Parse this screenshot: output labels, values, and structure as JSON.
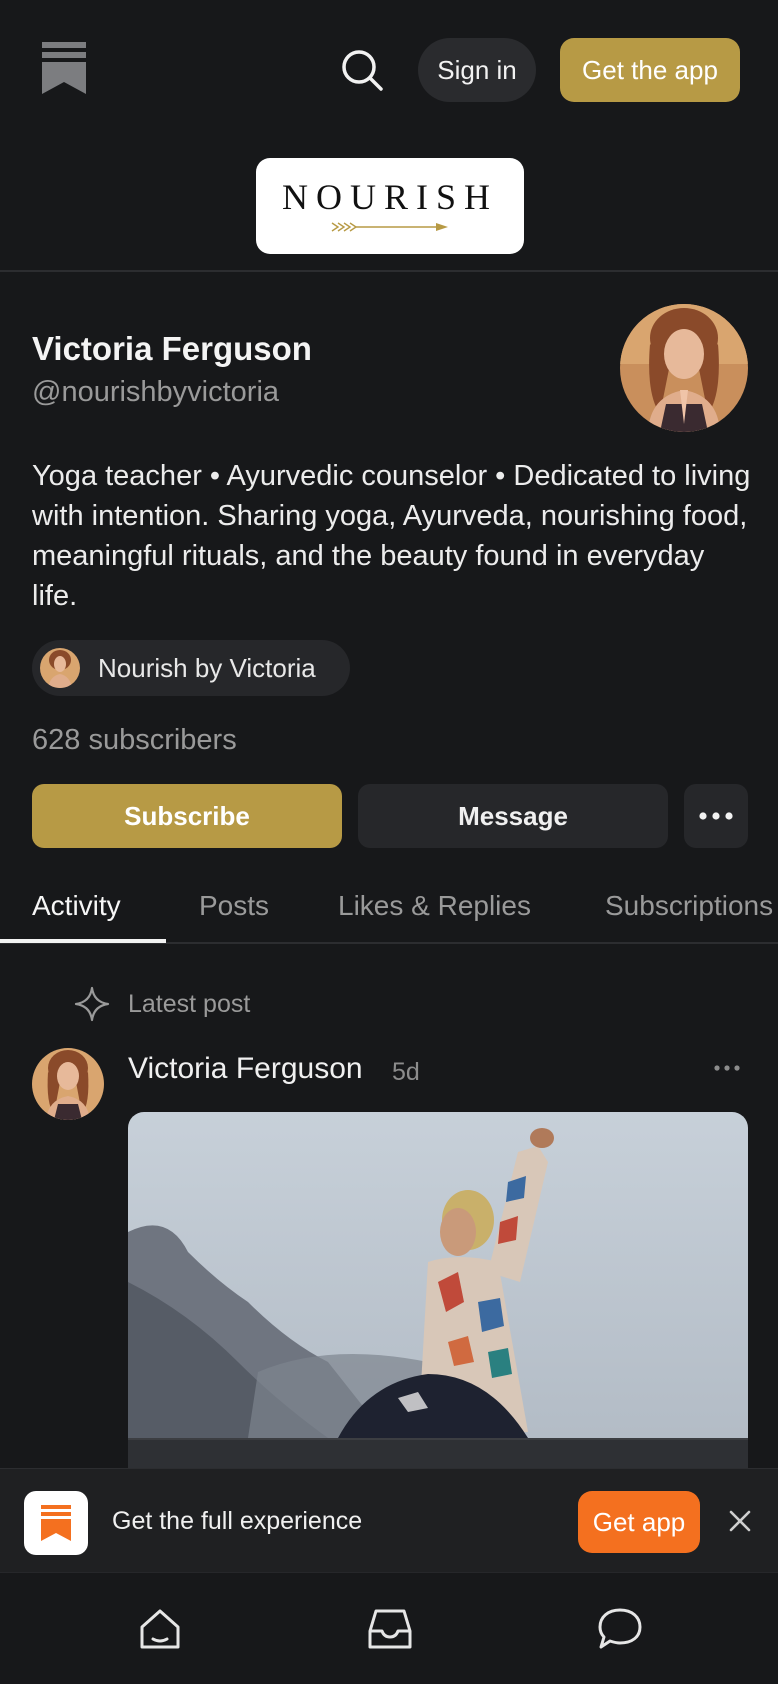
{
  "header": {
    "sign_in_label": "Sign in",
    "get_app_label": "Get the app",
    "publication_logo_text": "NOURISH"
  },
  "profile": {
    "name": "Victoria Ferguson",
    "handle": "@nourishbyvictoria",
    "bio": "Yoga teacher • Ayurvedic counselor • Dedicated to living with intention. Sharing yoga, Ayurveda, nourishing food, meaningful rituals, and the beauty found in everyday life.",
    "publication_name": "Nourish by Victoria",
    "subscribers": "628 subscribers",
    "subscribe_label": "Subscribe",
    "message_label": "Message"
  },
  "tabs": [
    {
      "label": "Activity",
      "active": true
    },
    {
      "label": "Posts",
      "active": false
    },
    {
      "label": "Likes & Replies",
      "active": false
    },
    {
      "label": "Subscriptions",
      "active": false
    }
  ],
  "latest_post": {
    "section_label": "Latest post",
    "author": "Victoria Ferguson",
    "time_ago": "5d"
  },
  "app_banner": {
    "text": "Get the full experience",
    "button_label": "Get app"
  },
  "bottom_nav": {
    "items": [
      "home-icon",
      "inbox-icon",
      "chat-icon"
    ]
  },
  "colors": {
    "background": "#17181a",
    "accent_gold": "#b79a45",
    "accent_orange": "#f4701f",
    "surface": "#26272a"
  }
}
